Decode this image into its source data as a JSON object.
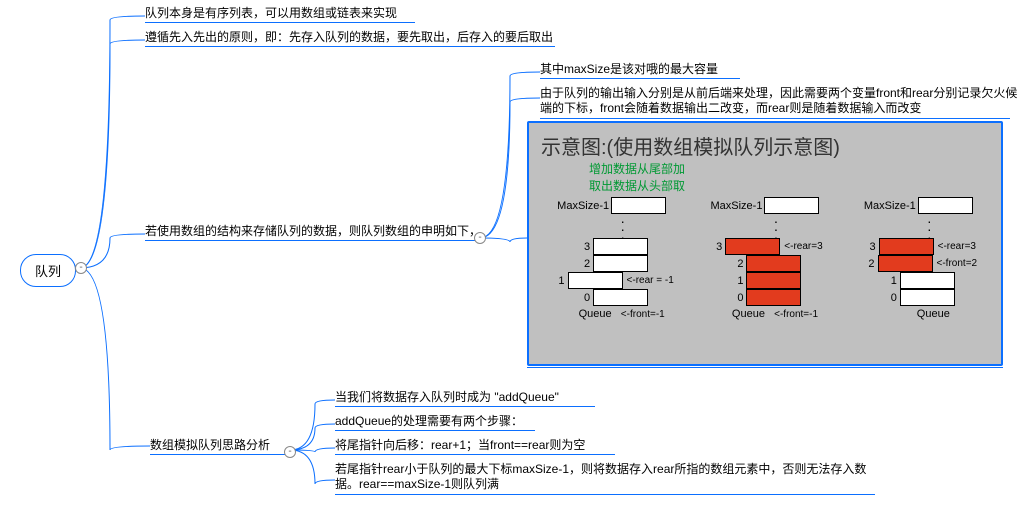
{
  "root": {
    "label": "队列"
  },
  "branch1": {
    "text": "队列本身是有序列表，可以用数组或链表来实现"
  },
  "branch2": {
    "text": "遵循先入先出的原则，即：先存入队列的数据，要先取出，后存入的要后取出"
  },
  "branch3": {
    "text": "若使用数组的结构来存储队列的数据，则队列数组的申明如下，",
    "sub1": "其中maxSize是该对哦的最大容量",
    "sub2": "由于队列的输出输入分别是从前后端来处理，因此需要两个变量front和rear分别记录欠火候端的下标，front会随着数据输出二改变，而rear则是随着数据输入而改变",
    "diagram": {
      "title": "示意图:(使用数组模拟队列示意图)",
      "note_add": "增加数据从尾部加",
      "note_remove": "取出数据从头部取",
      "maxsize_label": "MaxSize-1",
      "queue_caption": "Queue",
      "q1": {
        "rear": "<-rear = -1",
        "front": "<-front=-1"
      },
      "q2": {
        "rear": "<-rear=3",
        "front": "<-front=-1"
      },
      "q3": {
        "rear": "<-rear=3",
        "front": "<-front=2"
      }
    }
  },
  "branch4": {
    "text": "数组模拟队列思路分析",
    "sub1": "当我们将数据存入队列时成为  \"addQueue\"",
    "sub2": "addQueue的处理需要有两个步骤：",
    "sub3": "将尾指针向后移：rear+1；当front==rear则为空",
    "sub4": "若尾指针rear小于队列的最大下标maxSize-1，则将数据存入rear所指的数组元素中，否则无法存入数据。rear==maxSize-1则队列满"
  },
  "connector_glyph": "-"
}
